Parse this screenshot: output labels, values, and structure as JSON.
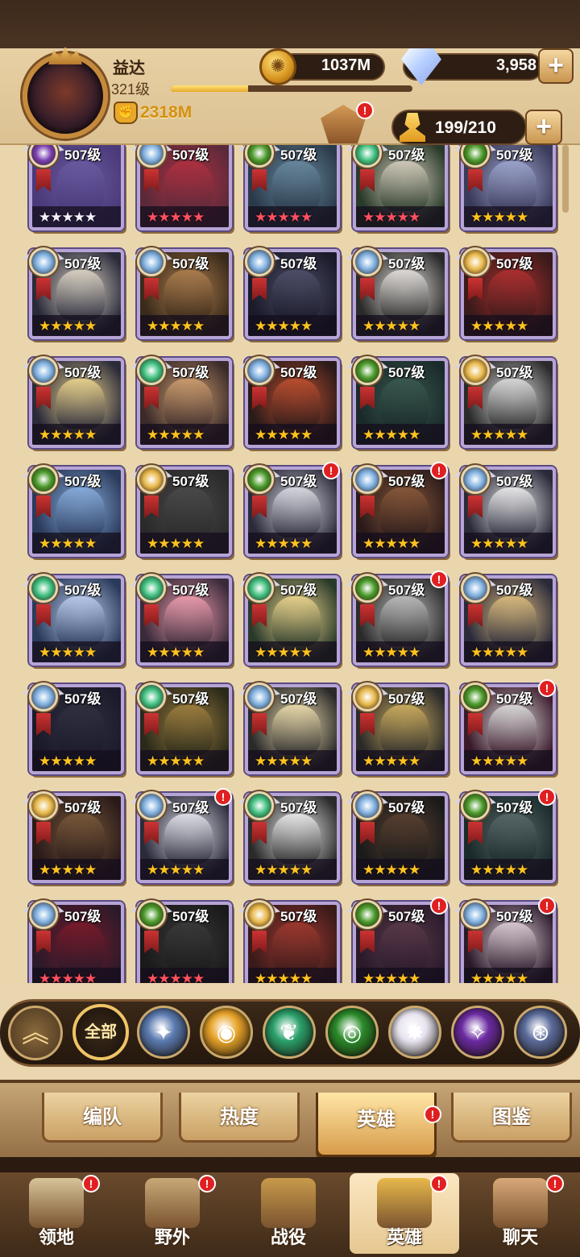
{
  "player": {
    "name": "益达",
    "level": "321级",
    "xp_fraction": 0.32,
    "power": "2318M"
  },
  "currencies": {
    "gold": "1037M",
    "gems": "3,958",
    "add_symbol": "+"
  },
  "roster": {
    "count": "199/210",
    "add_symbol": "+"
  },
  "alert_symbol": "!",
  "star_glyphs": "★★★★★",
  "faction_colors": {
    "celestial": "#7fb0e0",
    "lightbearer": "#e8b84a",
    "wilder": "#3fbf7f",
    "graveborn": "#4a9a2a",
    "mauler": "#c89a4a",
    "hypogean": "#7a3fb0"
  },
  "heroes": [
    {
      "level": "507级",
      "faction": "hypogean",
      "stars": "white",
      "bg": "#4a3a7a",
      "bust": "#6a5aa0",
      "alert": false
    },
    {
      "level": "507级",
      "faction": "celestial",
      "stars": "red",
      "bg": "#5a2a3a",
      "bust": "#b03040",
      "alert": false
    },
    {
      "level": "507级",
      "faction": "graveborn",
      "stars": "red",
      "bg": "#2a3a4a",
      "bust": "#6a8aa0",
      "alert": false
    },
    {
      "level": "507级",
      "faction": "wilder",
      "stars": "red",
      "bg": "#2a3a2a",
      "bust": "#d8d0c0",
      "alert": false
    },
    {
      "level": "507级",
      "faction": "graveborn",
      "stars": "gold",
      "bg": "#3a3a5a",
      "bust": "#a0a8d0",
      "alert": false
    },
    {
      "level": "507级",
      "faction": "celestial",
      "stars": "gold",
      "bg": "#2a2a3a",
      "bust": "#e0d8c8",
      "alert": false
    },
    {
      "level": "507级",
      "faction": "celestial",
      "stars": "gold",
      "bg": "#3a2a1a",
      "bust": "#b08050",
      "alert": false
    },
    {
      "level": "507级",
      "faction": "celestial",
      "stars": "gold",
      "bg": "#1a1a2a",
      "bust": "#50506a",
      "alert": false
    },
    {
      "level": "507级",
      "faction": "celestial",
      "stars": "gold",
      "bg": "#2a2a2a",
      "bust": "#e8e4e0",
      "alert": false
    },
    {
      "level": "507级",
      "faction": "lightbearer",
      "stars": "gold",
      "bg": "#3a1a1a",
      "bust": "#b03030",
      "alert": false
    },
    {
      "level": "507级",
      "faction": "celestial",
      "stars": "gold",
      "bg": "#2a2a3a",
      "bust": "#f0d890",
      "alert": false
    },
    {
      "level": "507级",
      "faction": "wilder",
      "stars": "gold",
      "bg": "#3a2a2a",
      "bust": "#d0a070",
      "alert": false
    },
    {
      "level": "507级",
      "faction": "celestial",
      "stars": "gold",
      "bg": "#2a1a1a",
      "bust": "#c05030",
      "alert": false
    },
    {
      "level": "507级",
      "faction": "graveborn",
      "stars": "gold",
      "bg": "#1a2a2a",
      "bust": "#3a5a50",
      "alert": false
    },
    {
      "level": "507级",
      "faction": "lightbearer",
      "stars": "gold",
      "bg": "#2a2a2a",
      "bust": "#e0e0e0",
      "alert": false
    },
    {
      "level": "507级",
      "faction": "graveborn",
      "stars": "gold",
      "bg": "#2a3a5a",
      "bust": "#8ab0e0",
      "alert": false
    },
    {
      "level": "507级",
      "faction": "lightbearer",
      "stars": "gold",
      "bg": "#2a2a2a",
      "bust": "#4a4a4a",
      "alert": false
    },
    {
      "level": "507级",
      "faction": "graveborn",
      "stars": "gold",
      "bg": "#2a2a3a",
      "bust": "#e0e0e8",
      "alert": true
    },
    {
      "level": "507级",
      "faction": "celestial",
      "stars": "gold",
      "bg": "#2a1a1a",
      "bust": "#8a5a3a",
      "alert": true
    },
    {
      "level": "507级",
      "faction": "celestial",
      "stars": "gold",
      "bg": "#2a2a3a",
      "bust": "#f0f0f0",
      "alert": false
    },
    {
      "level": "507级",
      "faction": "wilder",
      "stars": "gold",
      "bg": "#2a3a5a",
      "bust": "#c0d0f0",
      "alert": false
    },
    {
      "level": "507级",
      "faction": "wilder",
      "stars": "gold",
      "bg": "#3a2a3a",
      "bust": "#f0a0b0",
      "alert": false
    },
    {
      "level": "507级",
      "faction": "wilder",
      "stars": "gold",
      "bg": "#2a3a2a",
      "bust": "#f0d890",
      "alert": false
    },
    {
      "level": "507级",
      "faction": "graveborn",
      "stars": "gold",
      "bg": "#2a2a2a",
      "bust": "#c0c0c0",
      "alert": true
    },
    {
      "level": "507级",
      "faction": "celestial",
      "stars": "gold",
      "bg": "#2a2a3a",
      "bust": "#e0c080",
      "alert": false
    },
    {
      "level": "507级",
      "faction": "celestial",
      "stars": "gold",
      "bg": "#1a1a2a",
      "bust": "#303040",
      "alert": false
    },
    {
      "level": "507级",
      "faction": "wilder",
      "stars": "gold",
      "bg": "#2a2a1a",
      "bust": "#a08040",
      "alert": false
    },
    {
      "level": "507级",
      "faction": "celestial",
      "stars": "gold",
      "bg": "#2a2a2a",
      "bust": "#f0e0b0",
      "alert": false
    },
    {
      "level": "507级",
      "faction": "lightbearer",
      "stars": "gold",
      "bg": "#2a2a2a",
      "bust": "#d0b060",
      "alert": false
    },
    {
      "level": "507级",
      "faction": "graveborn",
      "stars": "gold",
      "bg": "#3a1a2a",
      "bust": "#e0e0e0",
      "alert": true
    },
    {
      "level": "507级",
      "faction": "lightbearer",
      "stars": "gold",
      "bg": "#2a1a1a",
      "bust": "#7a5a3a",
      "alert": false
    },
    {
      "level": "507级",
      "faction": "celestial",
      "stars": "gold",
      "bg": "#2a2a3a",
      "bust": "#e8e8f0",
      "alert": true
    },
    {
      "level": "507级",
      "faction": "wilder",
      "stars": "gold",
      "bg": "#2a2a2a",
      "bust": "#f0f0f0",
      "alert": false
    },
    {
      "level": "507级",
      "faction": "celestial",
      "stars": "gold",
      "bg": "#1a1a1a",
      "bust": "#5a4030",
      "alert": false
    },
    {
      "level": "507级",
      "faction": "graveborn",
      "stars": "gold",
      "bg": "#1a2a2a",
      "bust": "#5a6a6a",
      "alert": true
    },
    {
      "level": "507级",
      "faction": "celestial",
      "stars": "red",
      "bg": "#2a1a2a",
      "bust": "#7a1a2a",
      "alert": false
    },
    {
      "level": "507级",
      "faction": "graveborn",
      "stars": "red",
      "bg": "#1a1a1a",
      "bust": "#3a3a3a",
      "alert": false
    },
    {
      "level": "507级",
      "faction": "lightbearer",
      "stars": "gold",
      "bg": "#3a1a1a",
      "bust": "#a03a30",
      "alert": false
    },
    {
      "level": "507级",
      "faction": "graveborn",
      "stars": "gold",
      "bg": "#2a1a2a",
      "bust": "#5a3a4a",
      "alert": true
    },
    {
      "level": "507级",
      "faction": "celestial",
      "stars": "gold",
      "bg": "#2a1a2a",
      "bust": "#e0d0d8",
      "alert": true
    }
  ],
  "filters": [
    {
      "id": "collapse",
      "glyph": "︽"
    },
    {
      "id": "all",
      "label": "全部"
    },
    {
      "id": "lightbearer",
      "color": "#5a7ab0",
      "glyph": "✦"
    },
    {
      "id": "mauler",
      "color": "#e8a42a",
      "glyph": "◉"
    },
    {
      "id": "wilder",
      "color": "#2aa06a",
      "glyph": "❦"
    },
    {
      "id": "graveborn",
      "color": "#2a8a2a",
      "glyph": "◎"
    },
    {
      "id": "celestial",
      "color": "#e8e4f0",
      "glyph": "✸"
    },
    {
      "id": "hypogean",
      "color": "#6a2aa0",
      "glyph": "✧"
    },
    {
      "id": "dimensional",
      "color": "#5a6a9a",
      "glyph": "⊛"
    }
  ],
  "subtabs": [
    {
      "label": "编队",
      "active": false,
      "alert": false
    },
    {
      "label": "热度",
      "active": false,
      "alert": false
    },
    {
      "label": "英雄",
      "active": true,
      "alert": true
    },
    {
      "label": "图鉴",
      "active": false,
      "alert": false
    }
  ],
  "nav": [
    {
      "label": "领地",
      "active": false,
      "alert": true,
      "color": "#d8c49a"
    },
    {
      "label": "野外",
      "active": false,
      "alert": true,
      "color": "#c8a878"
    },
    {
      "label": "战役",
      "active": false,
      "alert": false,
      "color": "#c89a4a"
    },
    {
      "label": "英雄",
      "active": true,
      "alert": true,
      "color": "#e8b84a"
    },
    {
      "label": "聊天",
      "active": false,
      "alert": true,
      "color": "#d8a878"
    }
  ]
}
